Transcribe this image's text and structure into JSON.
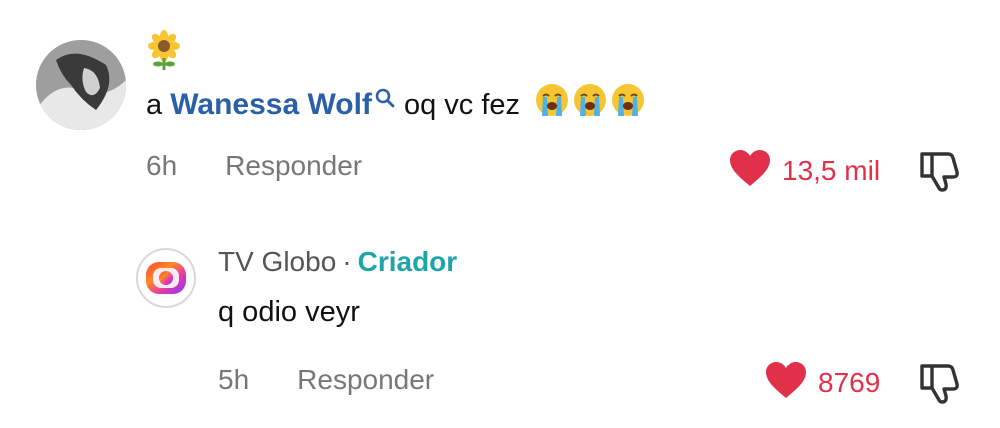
{
  "comment": {
    "author_emoji": "sunflower-icon",
    "text_prefix": "a",
    "mention": "Wanessa Wolf",
    "mention_icon": "search-icon",
    "text_suffix": "oq vc fez",
    "emojis": [
      "loudly-crying-face-icon",
      "loudly-crying-face-icon",
      "loudly-crying-face-icon"
    ],
    "time": "6h",
    "reply_label": "Responder",
    "likes": "13,5 mil"
  },
  "reply": {
    "author": "TV Globo",
    "separator": "·",
    "badge": "Criador",
    "text": "q odio veyr",
    "time": "5h",
    "reply_label": "Responder",
    "likes": "8769"
  },
  "colors": {
    "like": "#e1304a",
    "mention": "#2b5fa8",
    "creator": "#1fa4a8",
    "muted": "#777777"
  }
}
